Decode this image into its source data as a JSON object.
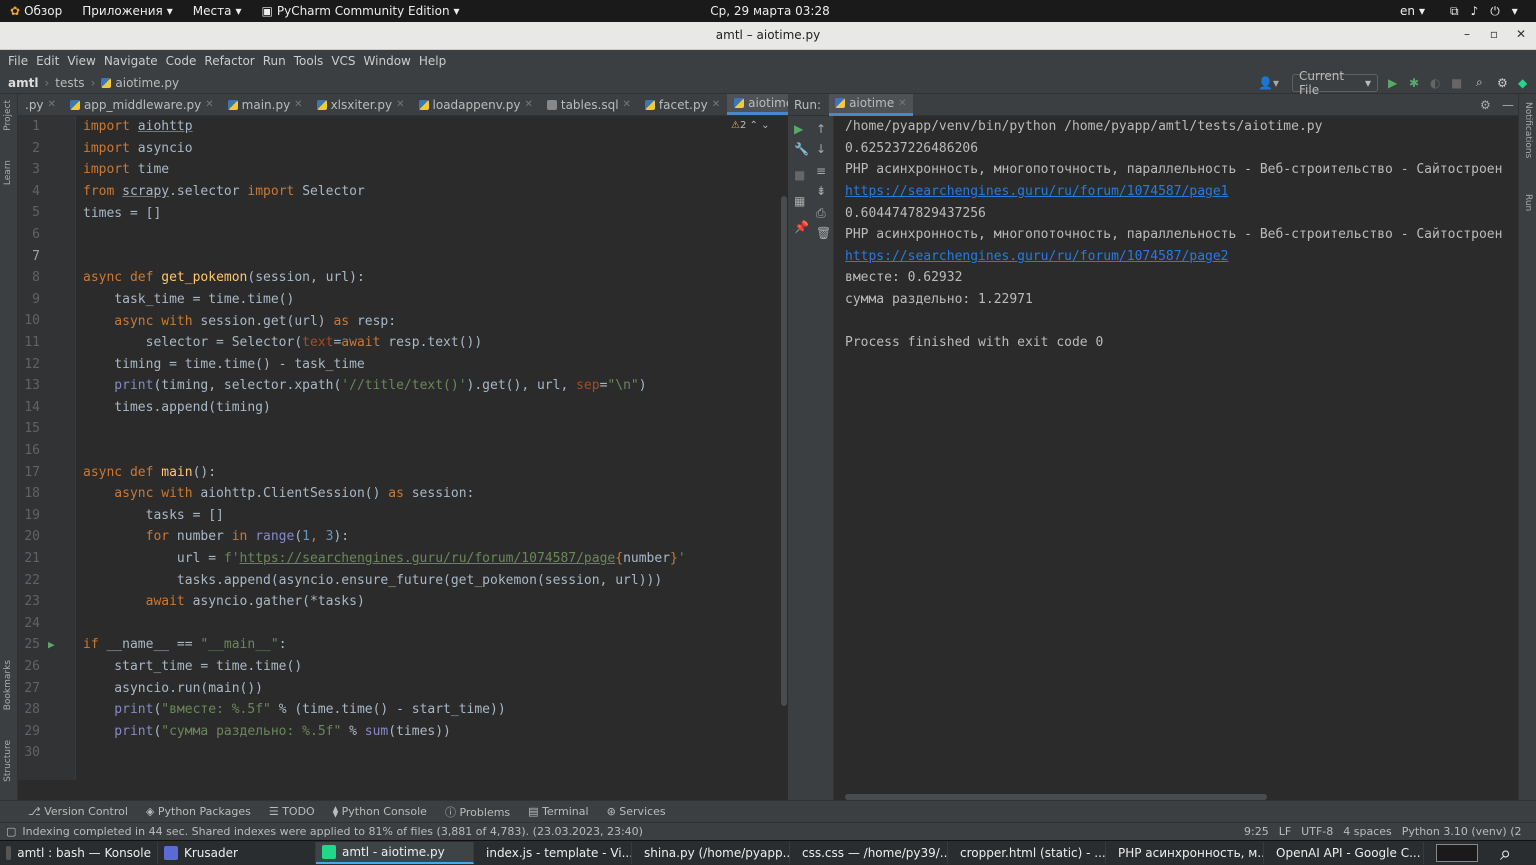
{
  "gnome": {
    "overview": "Обзор",
    "applications": "Приложения",
    "places": "Места",
    "app_name": "PyCharm Community Edition",
    "clock": "Ср, 29 марта  03:28",
    "lang": "en"
  },
  "window": {
    "title": "amtl – aiotime.py"
  },
  "menu": [
    "File",
    "Edit",
    "View",
    "Navigate",
    "Code",
    "Refactor",
    "Run",
    "Tools",
    "VCS",
    "Window",
    "Help"
  ],
  "breadcrumb": {
    "project": "amtl",
    "folder": "tests",
    "file": "aiotime.py"
  },
  "run_config": "Current File",
  "tabs": [
    {
      "label": ".py"
    },
    {
      "label": "app_middleware.py"
    },
    {
      "label": "main.py"
    },
    {
      "label": "xlsxiter.py"
    },
    {
      "label": "loadappenv.py"
    },
    {
      "label": "tables.sql"
    },
    {
      "label": "facet.py"
    },
    {
      "label": "aiotime.py"
    }
  ],
  "left_tools": [
    "Project",
    "Learn",
    "Bookmarks",
    "Structure"
  ],
  "right_tools": [
    "Notifications",
    "Run"
  ],
  "warnings": "2",
  "line_numbers": [
    "1",
    "2",
    "3",
    "4",
    "5",
    "6",
    "7",
    "8",
    "9",
    "10",
    "11",
    "12",
    "13",
    "14",
    "15",
    "16",
    "17",
    "18",
    "19",
    "20",
    "21",
    "22",
    "23",
    "24",
    "25",
    "26",
    "27",
    "28",
    "29",
    "30"
  ],
  "code": {
    "l1a": "import ",
    "l1b": "aiohttp",
    "l2a": "import ",
    "l2b": "asyncio",
    "l3a": "import ",
    "l3b": "time",
    "l4a": "from ",
    "l4b": "scrapy",
    ".": "",
    "l4c": ".selector ",
    "l4d": "import ",
    "l4e": "Selector",
    "l5": "times = []",
    "l8a": "async def ",
    "l8b": "get_pokemon",
    "l8c": "(session, url):",
    "l9": "    task_time = time.time()",
    "l10a": "    async with ",
    "l10b": "session.get(url) ",
    "l10c": "as ",
    "l10d": "resp:",
    "l11a": "        selector = Selector(",
    "l11b": "text",
    "l11c": "=",
    "l11d": "await ",
    "l11e": "resp.text())",
    "l12": "    timing = time.time() - task_time",
    "l13a": "    print",
    "l13b": "(timing, selector.xpath(",
    "l13c": "'//title/text()'",
    "l13d": ").get(), url, ",
    "l13e": "sep",
    "l13f": "=",
    "l13g": "\"\\n\"",
    "l13h": ")",
    "l14": "    times.append(timing)",
    "l17a": "async def ",
    "l17b": "main",
    "l17c": "():",
    "l18a": "    async with ",
    "l18b": "aiohttp.ClientSession() ",
    "l18c": "as ",
    "l18d": "session:",
    "l19": "        tasks = []",
    "l20a": "        for ",
    "l20b": "number ",
    "l20c": "in ",
    "l20d": "range",
    "l20e": "(",
    "l20f": "1",
    "l20g": ", ",
    "l20h": "3",
    "l20i": "):",
    "l21a": "            url = ",
    "l21b": "f'",
    "l21c": "https://searchengines.guru/ru/forum/1074587/page",
    "l21d": "{",
    "l21e": "number",
    "l21f": "}",
    "l21g": "'",
    "l22": "            tasks.append(asyncio.ensure_future(get_pokemon(session, url)))",
    "l23a": "        await ",
    "l23b": "asyncio.gather(*tasks)",
    "l25a": "if ",
    "l25b": "__name__ == ",
    "l25c": "\"__main__\"",
    "l25d": ":",
    "l26": "    start_time = time.time()",
    "l27": "    asyncio.run(main())",
    "l28a": "    print",
    "l28b": "(",
    "l28c": "\"вместе: %.5f\" ",
    "l28d": "% (time.time() - start_time))",
    "l29a": "    print",
    "l29b": "(",
    "l29c": "\"сумма раздельно: %.5f\" ",
    "l29d": "% ",
    "l29e": "sum",
    "l29f": "(times))"
  },
  "run": {
    "label": "Run:",
    "tab": "aiotime",
    "lines": [
      "/home/pyapp/venv/bin/python /home/pyapp/amtl/tests/aiotime.py",
      "0.625237226486206",
      "PHP асинхронность, многопоточность, параллельность - Веб-строительство - Сайтостроен",
      "https://searchengines.guru/ru/forum/1074587/page1",
      "0.6044747829437256",
      "PHP асинхронность, многопоточность, параллельность - Веб-строительство - Сайтостроен",
      "https://searchengines.guru/ru/forum/1074587/page2",
      "вместе: 0.62932",
      "сумма раздельно: 1.22971",
      "",
      "Process finished with exit code 0"
    ]
  },
  "bottom_tools": [
    "Version Control",
    "Python Packages",
    "TODO",
    "Python Console",
    "Problems",
    "Terminal",
    "Services"
  ],
  "status": {
    "message": "Indexing completed in 44 sec. Shared indexes were applied to 81% of files (3,881 of 4,783). (23.03.2023, 23:40)",
    "position": "9:25",
    "line_sep": "LF",
    "encoding": "UTF-8",
    "indent": "4 spaces",
    "interpreter": "Python 3.10 (venv) (2"
  },
  "taskbar": [
    {
      "label": "amtl : bash — Konsole",
      "color": "#555"
    },
    {
      "label": "Krusader",
      "color": "#5b6bd6"
    },
    {
      "label": "amtl - aiotime.py",
      "color": "#21d789"
    },
    {
      "label": "index.js - template - Vi...",
      "color": "#2f80ed"
    },
    {
      "label": "shina.py (/home/pyapp...",
      "color": "#cfcfcf"
    },
    {
      "label": "css.css — /home/py39/...",
      "color": "#3aa55b"
    },
    {
      "label": "cropper.html (static) - ...",
      "color": "#ffffff"
    },
    {
      "label": "PHP асинхронность, м...",
      "color": "#ff7a1a"
    },
    {
      "label": "OpenAI API - Google C...",
      "color": "#e94235"
    }
  ]
}
